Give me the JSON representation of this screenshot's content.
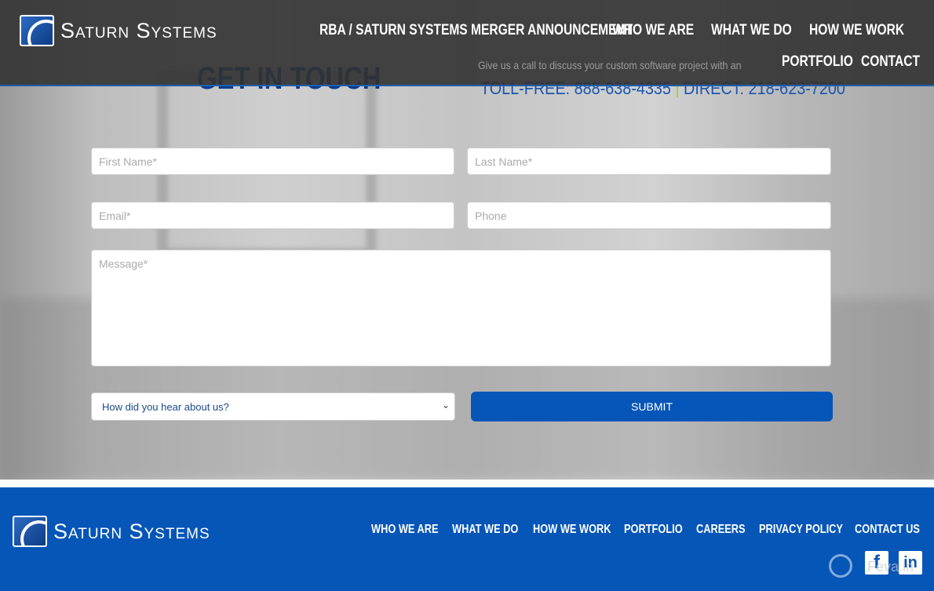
{
  "header": {
    "logo_text": "Saturn Systems",
    "nav": [
      "RBA / SATURN SYSTEMS MERGER ANNOUNCEMENT",
      "WHO WE ARE",
      "WHAT WE DO",
      "HOW WE WORK",
      "PORTFOLIO",
      "CONTACT"
    ]
  },
  "contact": {
    "title": "GET IN TOUCH",
    "call_text": "Give us a call to discuss your custom software project with an",
    "toll_free": "TOLL-FREE: 888-638-4335",
    "separator": "|",
    "direct": "DIRECT: 218-623-7200"
  },
  "form": {
    "first_name": "First Name*",
    "last_name": "Last Name*",
    "email": "Email*",
    "phone": "Phone",
    "message": "Message*",
    "referral_select": "How did you hear about us?",
    "submit": "SUBMIT"
  },
  "footer": {
    "logo_text": "Saturn Systems",
    "nav": [
      "WHO WE ARE",
      "WHAT WE DO",
      "HOW WE WORK",
      "PORTFOLIO",
      "CAREERS",
      "PRIVACY POLICY",
      "CONTACT US"
    ],
    "social": [
      "facebook-icon",
      "linkedin-icon"
    ],
    "watermark": "Feva.in"
  },
  "colors": {
    "brand_blue": "#0656b8",
    "title_blue": "#0a3d8f",
    "header_bg": "#323232"
  }
}
